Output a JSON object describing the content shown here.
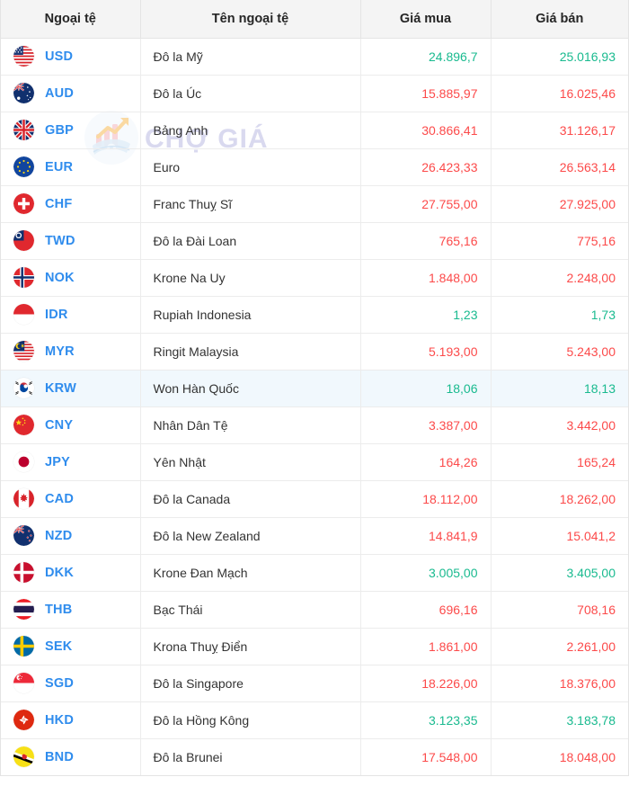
{
  "table": {
    "columns": [
      {
        "key": "code",
        "label": "Ngoại tệ"
      },
      {
        "key": "name",
        "label": "Tên ngoại tệ"
      },
      {
        "key": "buy",
        "label": "Giá mua"
      },
      {
        "key": "sell",
        "label": "Giá bán"
      }
    ],
    "rows": [
      {
        "code": "USD",
        "flag": "flag-us",
        "name": "Đô la Mỹ",
        "buy": "24.896,7",
        "sell": "25.016,93",
        "trend": "up",
        "highlight": false
      },
      {
        "code": "AUD",
        "flag": "flag-au",
        "name": "Đô la Úc",
        "buy": "15.885,97",
        "sell": "16.025,46",
        "trend": "down",
        "highlight": false
      },
      {
        "code": "GBP",
        "flag": "flag-gb",
        "name": "Bảng Anh",
        "buy": "30.866,41",
        "sell": "31.126,17",
        "trend": "down",
        "highlight": false
      },
      {
        "code": "EUR",
        "flag": "flag-eu",
        "name": "Euro",
        "buy": "26.423,33",
        "sell": "26.563,14",
        "trend": "down",
        "highlight": false
      },
      {
        "code": "CHF",
        "flag": "flag-ch",
        "name": "Franc Thuỵ Sĩ",
        "buy": "27.755,00",
        "sell": "27.925,00",
        "trend": "down",
        "highlight": false
      },
      {
        "code": "TWD",
        "flag": "flag-tw",
        "name": "Đô la Đài Loan",
        "buy": "765,16",
        "sell": "775,16",
        "trend": "down",
        "highlight": false
      },
      {
        "code": "NOK",
        "flag": "flag-no",
        "name": "Krone Na Uy",
        "buy": "1.848,00",
        "sell": "2.248,00",
        "trend": "down",
        "highlight": false
      },
      {
        "code": "IDR",
        "flag": "flag-id",
        "name": "Rupiah Indonesia",
        "buy": "1,23",
        "sell": "1,73",
        "trend": "up",
        "highlight": false
      },
      {
        "code": "MYR",
        "flag": "flag-my",
        "name": "Ringit Malaysia",
        "buy": "5.193,00",
        "sell": "5.243,00",
        "trend": "down",
        "highlight": false
      },
      {
        "code": "KRW",
        "flag": "flag-kr",
        "name": "Won Hàn Quốc",
        "buy": "18,06",
        "sell": "18,13",
        "trend": "up",
        "highlight": true
      },
      {
        "code": "CNY",
        "flag": "flag-cn",
        "name": "Nhân Dân Tệ",
        "buy": "3.387,00",
        "sell": "3.442,00",
        "trend": "down",
        "highlight": false
      },
      {
        "code": "JPY",
        "flag": "flag-jp",
        "name": "Yên Nhật",
        "buy": "164,26",
        "sell": "165,24",
        "trend": "down",
        "highlight": false
      },
      {
        "code": "CAD",
        "flag": "flag-ca",
        "name": "Đô la Canada",
        "buy": "18.112,00",
        "sell": "18.262,00",
        "trend": "down",
        "highlight": false
      },
      {
        "code": "NZD",
        "flag": "flag-nz",
        "name": "Đô la New Zealand",
        "buy": "14.841,9",
        "sell": "15.041,2",
        "trend": "down",
        "highlight": false
      },
      {
        "code": "DKK",
        "flag": "flag-dk",
        "name": "Krone Đan Mạch",
        "buy": "3.005,00",
        "sell": "3.405,00",
        "trend": "up",
        "highlight": false
      },
      {
        "code": "THB",
        "flag": "flag-th",
        "name": "Bạc Thái",
        "buy": "696,16",
        "sell": "708,16",
        "trend": "down",
        "highlight": false
      },
      {
        "code": "SEK",
        "flag": "flag-se",
        "name": "Krona Thuỵ Điển",
        "buy": "1.861,00",
        "sell": "2.261,00",
        "trend": "down",
        "highlight": false
      },
      {
        "code": "SGD",
        "flag": "flag-sg",
        "name": "Đô la Singapore",
        "buy": "18.226,00",
        "sell": "18.376,00",
        "trend": "down",
        "highlight": false
      },
      {
        "code": "HKD",
        "flag": "flag-hk",
        "name": "Đô la Hồng Kông",
        "buy": "3.123,35",
        "sell": "3.183,78",
        "trend": "up",
        "highlight": false
      },
      {
        "code": "BND",
        "flag": "flag-bn",
        "name": "Đô la Brunei",
        "buy": "17.548,00",
        "sell": "18.048,00",
        "trend": "down",
        "highlight": false
      }
    ]
  },
  "watermark": {
    "text": "CHỢ GIÁ",
    "icon": "chart-wallet-logo-icon"
  },
  "colors": {
    "up": "#19ba8f",
    "down": "#fc4a4a",
    "code": "#2f8ced",
    "header_bg": "#f4f4f4",
    "highlight_row": "#f1f8fd",
    "border": "#ececec"
  }
}
